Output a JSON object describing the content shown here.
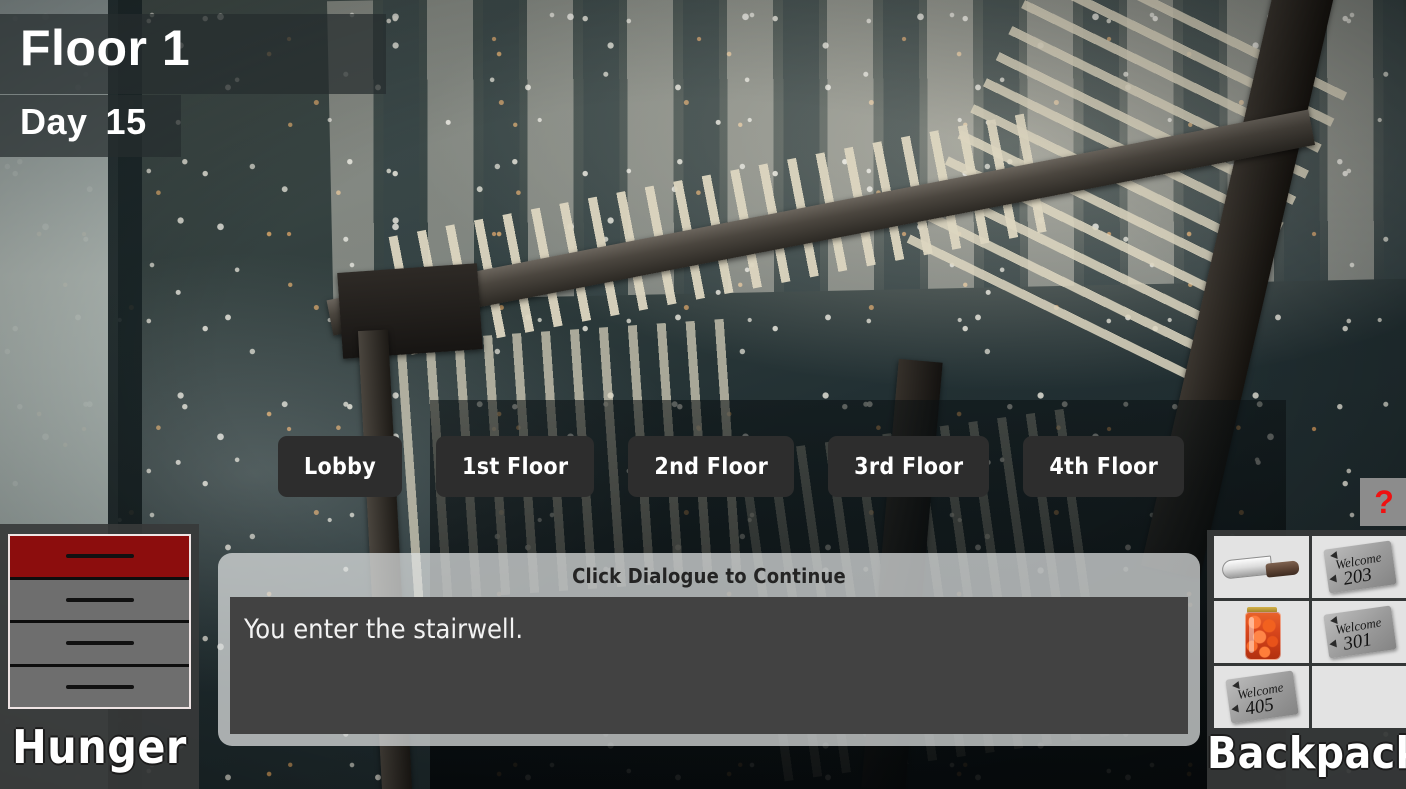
{
  "hud": {
    "floor_label": "Floor 1",
    "day_label": "Day",
    "day_value": "15"
  },
  "navigation": {
    "buttons": [
      {
        "label": "Lobby",
        "name": "floor-button-lobby"
      },
      {
        "label": "1st Floor",
        "name": "floor-button-1st"
      },
      {
        "label": "2nd Floor",
        "name": "floor-button-2nd"
      },
      {
        "label": "3rd Floor",
        "name": "floor-button-3rd"
      },
      {
        "label": "4th Floor",
        "name": "floor-button-4th"
      }
    ]
  },
  "help": {
    "label": "?",
    "color": "#ef1111"
  },
  "dialogue": {
    "header": "Click Dialogue to Continue",
    "text": "You enter the stairwell."
  },
  "hunger": {
    "label": "Hunger",
    "segments": 4,
    "filled": 1,
    "filled_color": "#8c0d0d",
    "empty_color": "#6e6e6e"
  },
  "backpack": {
    "label": "Backpack",
    "slots": [
      {
        "item": "knife",
        "icon": "knife-icon",
        "text": ""
      },
      {
        "item": "keycard",
        "icon": "keycard-icon",
        "welcome": "Welcome",
        "number": "203"
      },
      {
        "item": "food_jar",
        "icon": "tomato-jar-icon",
        "text": ""
      },
      {
        "item": "keycard",
        "icon": "keycard-icon",
        "welcome": "Welcome",
        "number": "301"
      },
      {
        "item": "keycard",
        "icon": "keycard-icon",
        "welcome": "Welcome",
        "number": "405"
      },
      {
        "item": "empty",
        "icon": "",
        "text": ""
      }
    ]
  },
  "scene": {
    "description": "Abandoned stairwell with peeling paint, metal beams and railings"
  }
}
